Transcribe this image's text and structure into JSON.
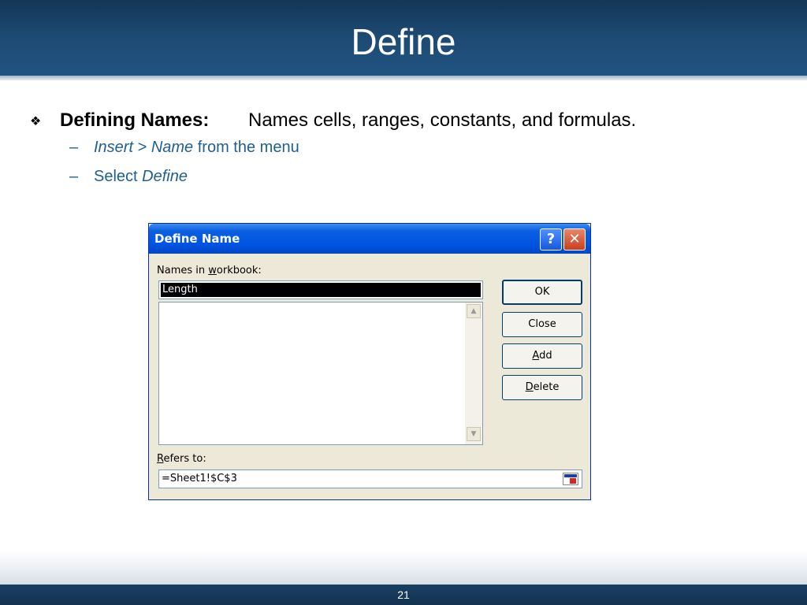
{
  "slide": {
    "title": "Define",
    "bullet": {
      "glyph": "❖",
      "bold": "Defining Names:",
      "text": "Names cells, ranges, constants, and formulas."
    },
    "sub1": {
      "dash": "–",
      "italic1": "Insert",
      "plain1": " > ",
      "italic2": "Name",
      "plain2": " from the menu"
    },
    "sub2": {
      "dash": "–",
      "plain": "Select ",
      "italic": "Define"
    },
    "page_number": "21"
  },
  "dialog": {
    "title": "Define Name",
    "help_glyph": "?",
    "close_glyph": "✕",
    "names_label_pre": "Names in ",
    "names_label_u": "w",
    "names_label_post": "orkbook:",
    "name_value": "Length",
    "buttons": {
      "ok": "OK",
      "close": "Close",
      "add_u": "A",
      "add_rest": "dd",
      "delete_u": "D",
      "delete_rest": "elete"
    },
    "refers_label_u": "R",
    "refers_label_rest": "efers to:",
    "refers_value": "=Sheet1!$C$3",
    "scroll_up": "▲",
    "scroll_down": "▼"
  }
}
